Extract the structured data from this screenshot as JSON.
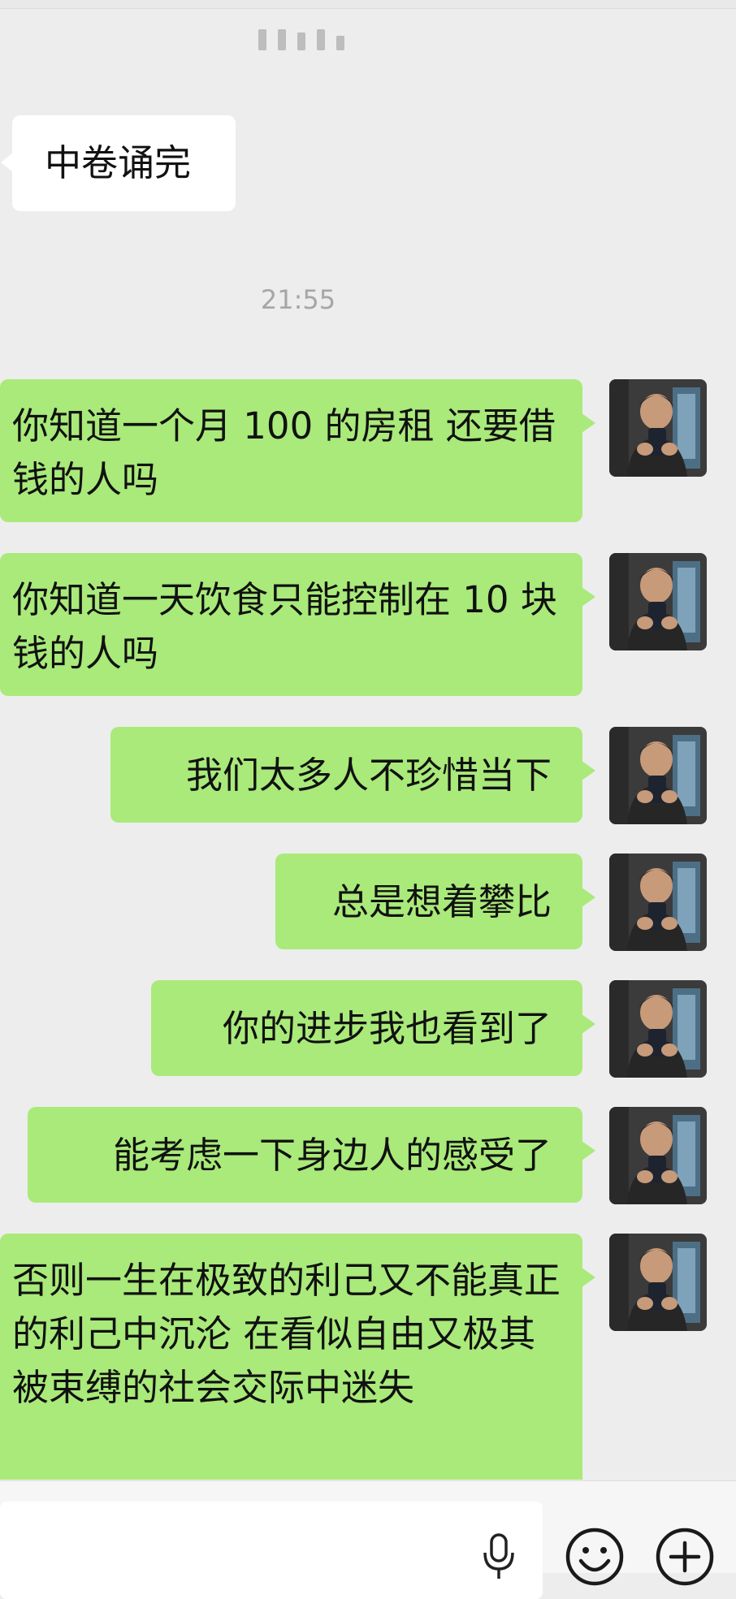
{
  "chat": {
    "timestamp": "21:55",
    "messages": [
      {
        "sender": "contact",
        "text": "中卷诵完"
      },
      {
        "sender": "me",
        "text": "你知道一个月 100 的房租 还要借钱的人吗"
      },
      {
        "sender": "me",
        "text": "你知道一天饮食只能控制在 10 块钱的人吗"
      },
      {
        "sender": "me",
        "text": "我们太多人不珍惜当下"
      },
      {
        "sender": "me",
        "text": "总是想着攀比"
      },
      {
        "sender": "me",
        "text": "你的进步我也看到了"
      },
      {
        "sender": "me",
        "text": "能考虑一下身边人的感受了"
      },
      {
        "sender": "me",
        "text": "否则一生在极致的利己又不能真正的利己中沉沦 在看似自由又极其被束缚的社会交际中迷失"
      }
    ]
  },
  "input_bar": {
    "value": "",
    "icons": [
      "microphone-icon",
      "emoji-icon",
      "plus-icon"
    ]
  },
  "colors": {
    "background": "#ededed",
    "sent_bubble": "#a9ea7a",
    "received_bubble": "#ffffff",
    "timestamp_text": "#a6a6a6"
  }
}
